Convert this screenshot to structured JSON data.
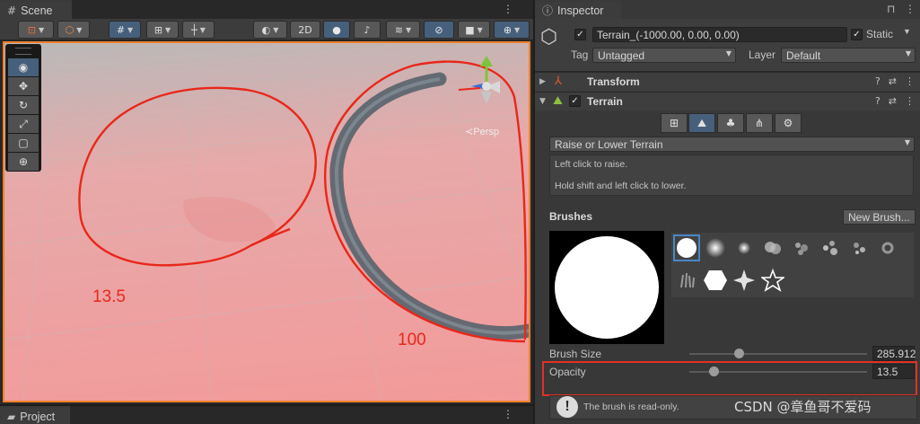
{
  "scene": {
    "tab_label": "Scene",
    "toolbar": {
      "mode_2d": "2D"
    },
    "viewport": {
      "persp_label": "≺Persp",
      "annotations": [
        "13.5",
        "100"
      ]
    },
    "project_tab_label": "Project"
  },
  "inspector": {
    "tab_label": "Inspector",
    "object_name": "Terrain_(-1000.00, 0.00, 0.00)",
    "static_label": "Static",
    "tag_label": "Tag",
    "tag_value": "Untagged",
    "layer_label": "Layer",
    "layer_value": "Default",
    "components": {
      "transform": "Transform",
      "terrain": "Terrain"
    },
    "tool_mode": "Raise or Lower Terrain",
    "help_lines": [
      "Left click to raise.",
      "Hold shift and left click to lower."
    ],
    "brushes_label": "Brushes",
    "new_brush_label": "New Brush...",
    "brush_size_label": "Brush Size",
    "brush_size_value": "285.912",
    "brush_size_fraction": 0.28,
    "opacity_label": "Opacity",
    "opacity_value": "13.5",
    "opacity_fraction": 0.135,
    "readonly_message": "The brush is read-only."
  },
  "watermark": "CSDN @章鱼哥不爱码",
  "colors": {
    "selection_blue": "#46607c",
    "scene_border": "#f0812a",
    "annotation_red": "#e8271a"
  }
}
